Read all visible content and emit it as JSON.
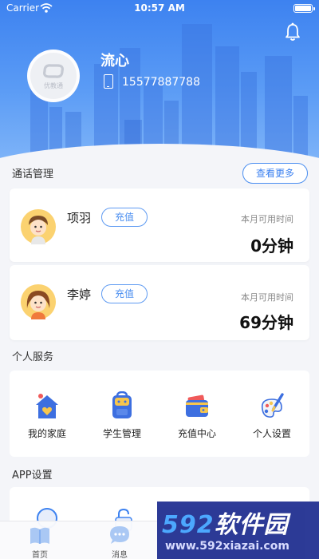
{
  "status_bar": {
    "carrier": "Carrier",
    "time": "10:57 AM"
  },
  "profile": {
    "username": "流心",
    "phone": "15577887788",
    "avatar_text": "优教通"
  },
  "call_management": {
    "title": "通话管理",
    "more_label": "查看更多",
    "contacts": [
      {
        "name": "项羽",
        "recharge_label": "充值",
        "available_label": "本月可用时间",
        "available_value": "0分钟"
      },
      {
        "name": "李婷",
        "recharge_label": "充值",
        "available_label": "本月可用时间",
        "available_value": "69分钟"
      }
    ]
  },
  "personal_services": {
    "title": "个人服务",
    "items": [
      {
        "label": "我的家庭",
        "icon": "home-heart-icon"
      },
      {
        "label": "学生管理",
        "icon": "backpack-icon"
      },
      {
        "label": "充值中心",
        "icon": "wallet-icon"
      },
      {
        "label": "个人设置",
        "icon": "palette-brush-icon"
      }
    ]
  },
  "app_settings": {
    "title": "APP设置"
  },
  "tab_bar": {
    "items": [
      {
        "label": "首页",
        "icon": "home-book-icon"
      },
      {
        "label": "消息",
        "icon": "message-icon"
      }
    ]
  },
  "watermark": {
    "title_num": "592",
    "title_text": "软件园",
    "url": "www.592xiazai.com"
  },
  "colors": {
    "primary": "#3d82f0",
    "header_gradient_end": "#7db3f8",
    "background": "#f4f5f9",
    "watermark": "#1d2c8f"
  }
}
